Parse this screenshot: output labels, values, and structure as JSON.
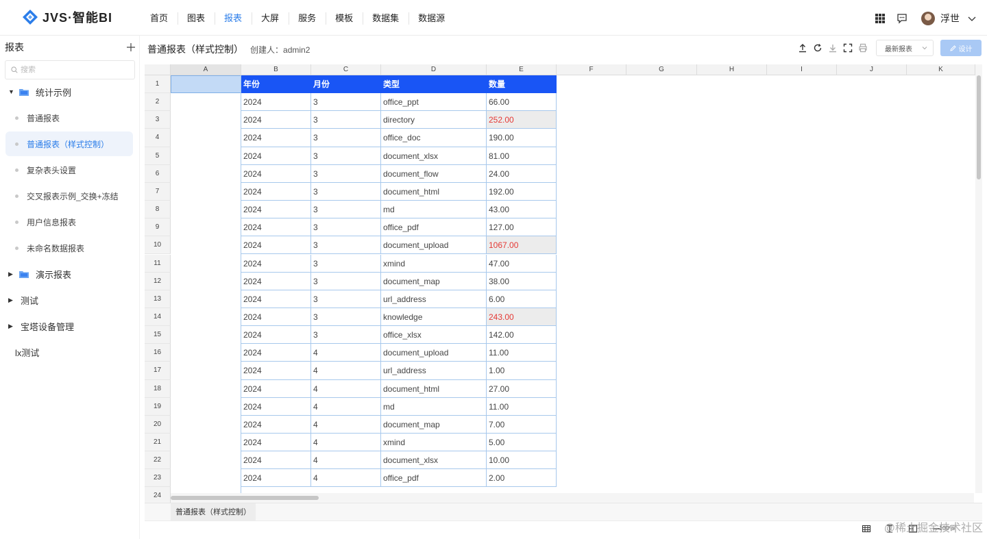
{
  "app": {
    "logo_text": "JVS·智能BI"
  },
  "nav": {
    "items": [
      "首页",
      "图表",
      "报表",
      "大屏",
      "服务",
      "模板",
      "数据集",
      "数据源"
    ],
    "active": "报表"
  },
  "user": {
    "name": "浮世"
  },
  "sidebar": {
    "title": "报表",
    "search_placeholder": "搜索",
    "tree": [
      {
        "label": "统计示例",
        "type": "folder",
        "expanded": true
      },
      {
        "label": "普通报表",
        "type": "leaf"
      },
      {
        "label": "普通报表（样式控制）",
        "type": "leaf",
        "selected": true
      },
      {
        "label": "复杂表头设置",
        "type": "leaf"
      },
      {
        "label": "交叉报表示例_交换+冻结",
        "type": "leaf"
      },
      {
        "label": "用户信息报表",
        "type": "leaf"
      },
      {
        "label": "未命名数据报表",
        "type": "leaf"
      },
      {
        "label": "演示报表",
        "type": "folder",
        "expanded": false
      },
      {
        "label": "测试",
        "type": "group"
      },
      {
        "label": "宝塔设备管理",
        "type": "group"
      },
      {
        "label": "lx测试",
        "type": "plain"
      }
    ]
  },
  "report": {
    "title": "普通报表（样式控制）",
    "creator_label": "创建人：",
    "creator": "admin2",
    "version_select": "最新报表",
    "design_label": "设计"
  },
  "sheet": {
    "columns": [
      "A",
      "B",
      "C",
      "D",
      "E",
      "F",
      "G",
      "H",
      "I",
      "J",
      "K"
    ],
    "header": [
      "年份",
      "月份",
      "类型",
      "数量"
    ],
    "rows": [
      [
        "2024",
        "3",
        "office_ppt",
        "66.00",
        false
      ],
      [
        "2024",
        "3",
        "directory",
        "252.00",
        true
      ],
      [
        "2024",
        "3",
        "office_doc",
        "190.00",
        false
      ],
      [
        "2024",
        "3",
        "document_xlsx",
        "81.00",
        false
      ],
      [
        "2024",
        "3",
        "document_flow",
        "24.00",
        false
      ],
      [
        "2024",
        "3",
        "document_html",
        "192.00",
        false
      ],
      [
        "2024",
        "3",
        "md",
        "43.00",
        false
      ],
      [
        "2024",
        "3",
        "office_pdf",
        "127.00",
        false
      ],
      [
        "2024",
        "3",
        "document_upload",
        "1067.00",
        true
      ],
      [
        "2024",
        "3",
        "xmind",
        "47.00",
        false
      ],
      [
        "2024",
        "3",
        "document_map",
        "38.00",
        false
      ],
      [
        "2024",
        "3",
        "url_address",
        "6.00",
        false
      ],
      [
        "2024",
        "3",
        "knowledge",
        "243.00",
        true
      ],
      [
        "2024",
        "3",
        "office_xlsx",
        "142.00",
        false
      ],
      [
        "2024",
        "4",
        "document_upload",
        "11.00",
        false
      ],
      [
        "2024",
        "4",
        "url_address",
        "1.00",
        false
      ],
      [
        "2024",
        "4",
        "document_html",
        "27.00",
        false
      ],
      [
        "2024",
        "4",
        "md",
        "11.00",
        false
      ],
      [
        "2024",
        "4",
        "document_map",
        "7.00",
        false
      ],
      [
        "2024",
        "4",
        "xmind",
        "5.00",
        false
      ],
      [
        "2024",
        "4",
        "document_xlsx",
        "10.00",
        false
      ],
      [
        "2024",
        "4",
        "office_pdf",
        "2.00",
        false
      ]
    ],
    "tab_label": "普通报表（样式控制）",
    "zoom": "100%"
  },
  "colors": {
    "accent": "#2b7de9",
    "header_bg": "#1955f5",
    "highlight_text": "#e53935"
  },
  "watermark": "@稀土掘金技术社区"
}
